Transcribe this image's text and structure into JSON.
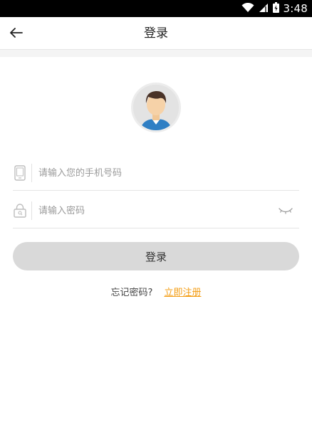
{
  "status_bar": {
    "time": "3:48",
    "icons": [
      "wifi-icon",
      "signal-icon",
      "battery-icon"
    ]
  },
  "app_bar": {
    "back_icon": "arrow-left-icon",
    "title": "登录"
  },
  "avatar": {
    "icon": "user-avatar-icon"
  },
  "form": {
    "phone": {
      "icon": "phone-icon",
      "placeholder": "请输入您的手机号码",
      "value": ""
    },
    "password": {
      "icon": "lock-icon",
      "placeholder": "请输入密码",
      "value": "",
      "toggle_icon": "eye-closed-icon"
    },
    "login_label": "登录"
  },
  "links": {
    "forgot": "忘记密码?",
    "register": "立即注册"
  },
  "colors": {
    "accent": "#f39c12",
    "button_bg": "#d9d9d9",
    "status_bar": "#000000"
  }
}
